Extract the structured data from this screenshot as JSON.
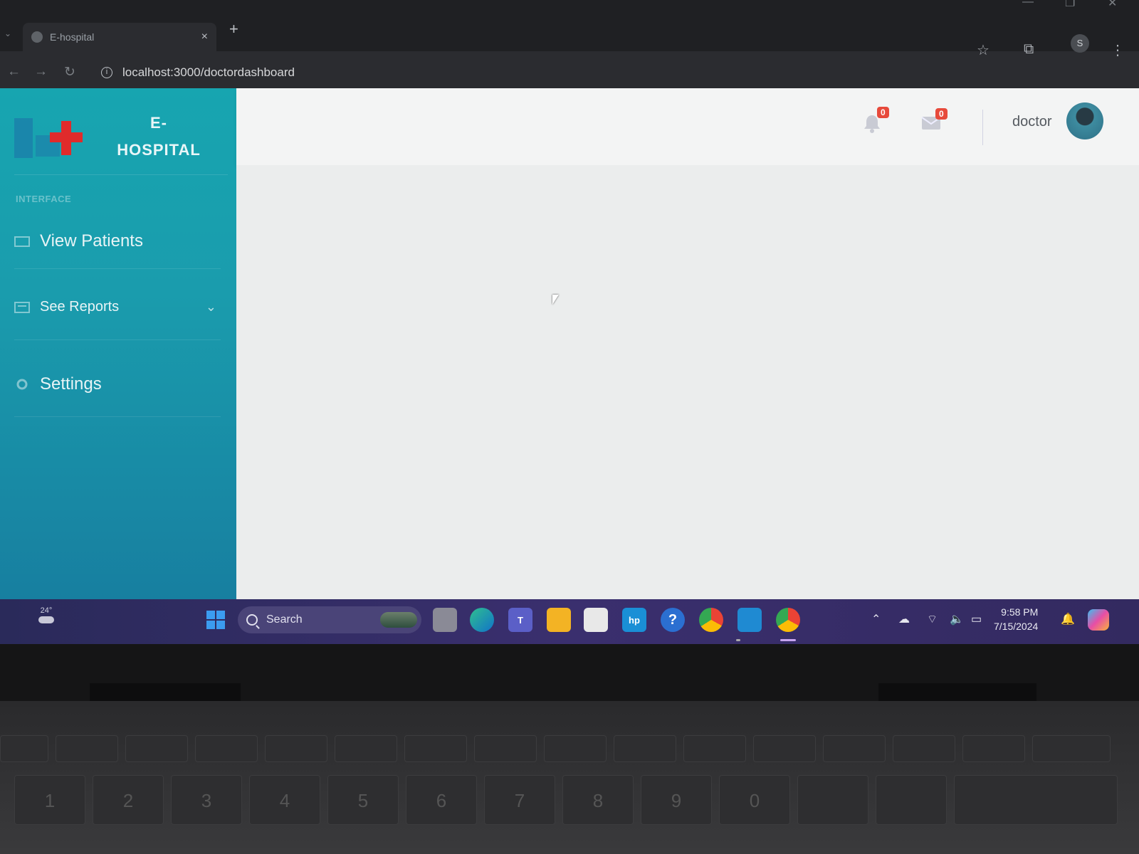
{
  "browser": {
    "tab_title": "E-hospital",
    "tab_close": "×",
    "new_tab": "+",
    "url": "localhost:3000/doctordashboard",
    "profile_initial": "S"
  },
  "app": {
    "brand_line1": "E-",
    "brand_line2": "HOSPITAL",
    "section_heading": "INTERFACE",
    "nav": [
      {
        "label": "View Patients"
      },
      {
        "label": "See Reports"
      },
      {
        "label": "Settings"
      }
    ],
    "alerts_count": "0",
    "messages_count": "0",
    "user_name": "doctor"
  },
  "taskbar": {
    "weather_temp": "24°",
    "search_placeholder": "Search",
    "time": "9:58 PM",
    "date": "7/15/2024"
  },
  "colors": {
    "sidebar": "#17a5b0",
    "badge": "#e74a3b",
    "taskbar": "#2a2a5a"
  },
  "keyboard_labels": [
    "1",
    "2",
    "3",
    "4",
    "5",
    "6",
    "7",
    "8",
    "9",
    "0"
  ]
}
